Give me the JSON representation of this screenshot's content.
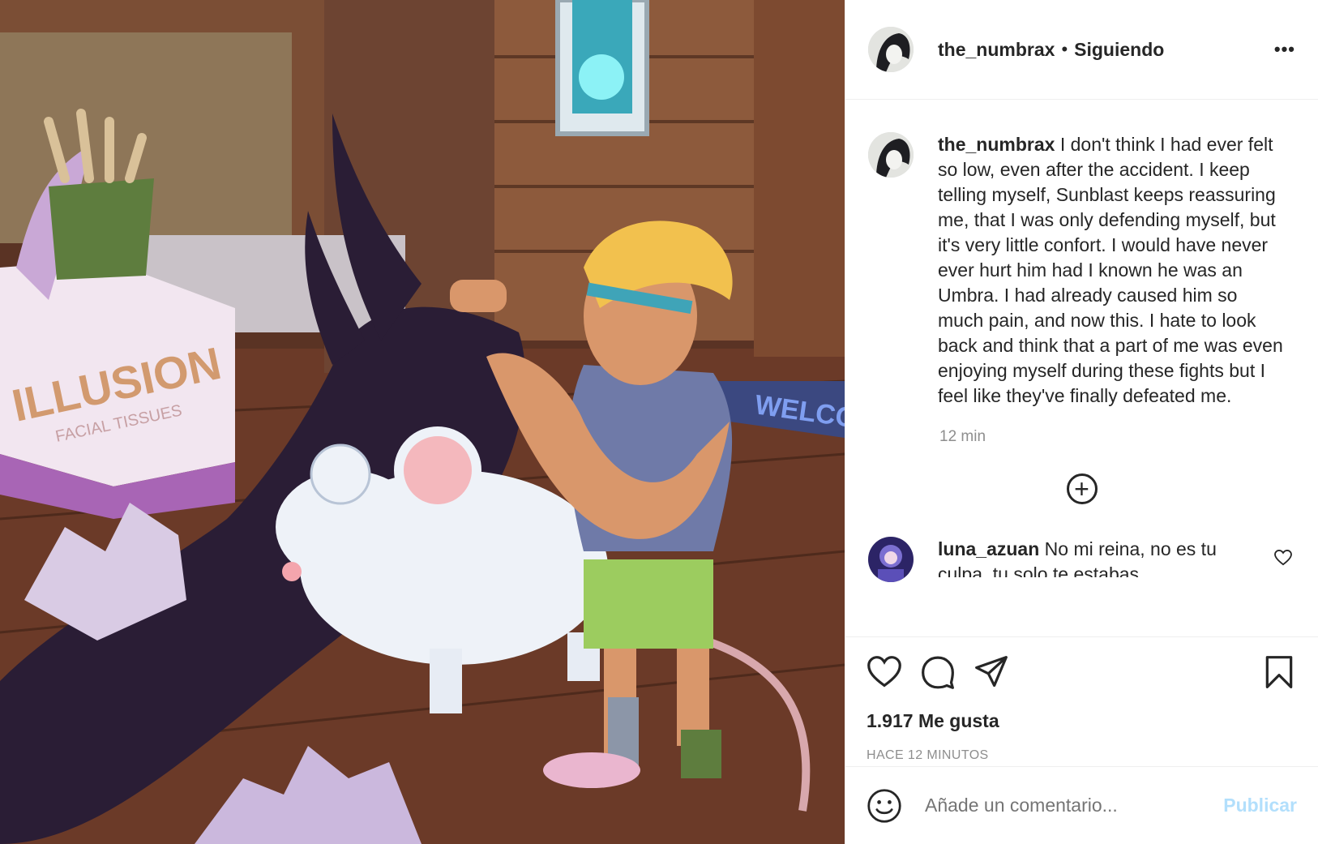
{
  "post": {
    "header": {
      "username": "the_numbrax",
      "separator": "•",
      "follow_status": "Siguiendo",
      "more_label": "..."
    },
    "image": {
      "tissue_brand": "ILLUSION",
      "tissue_subtitle": "FACIAL TISSUES",
      "mat_text": "WELCOME"
    },
    "caption": {
      "username": "the_numbrax",
      "text": " I don't think I had ever felt so low, even after the accident. I keep telling myself, Sunblast keeps reassuring me, that I was only defending myself, but it's very little confort. I would have never ever hurt him had I known he was an Umbra. I had already caused him so much pain, and now this. I hate to look back and think that a part of me was even enjoying myself during these fights but I feel like they've finally defeated me.",
      "time": "12 min"
    },
    "load_more_label": "+",
    "comments": [
      {
        "username": "luna_azuan",
        "text": " No mi reina, no es tu culpa, tu solo te estabas"
      }
    ],
    "likes": "1.917 Me gusta",
    "date": "HACE 12 MINUTOS",
    "add_comment": {
      "placeholder": "Añade un comentario...",
      "publish_label": "Publicar"
    },
    "colors": {
      "accent": "#0095f6",
      "publish_disabled": "#b2dffc",
      "muted": "#8e8e8e",
      "text": "#262626"
    },
    "icons": [
      "heart-icon",
      "comment-icon",
      "share-icon",
      "bookmark-icon",
      "emoji-icon",
      "plus-circle-icon",
      "more-icon"
    ]
  }
}
